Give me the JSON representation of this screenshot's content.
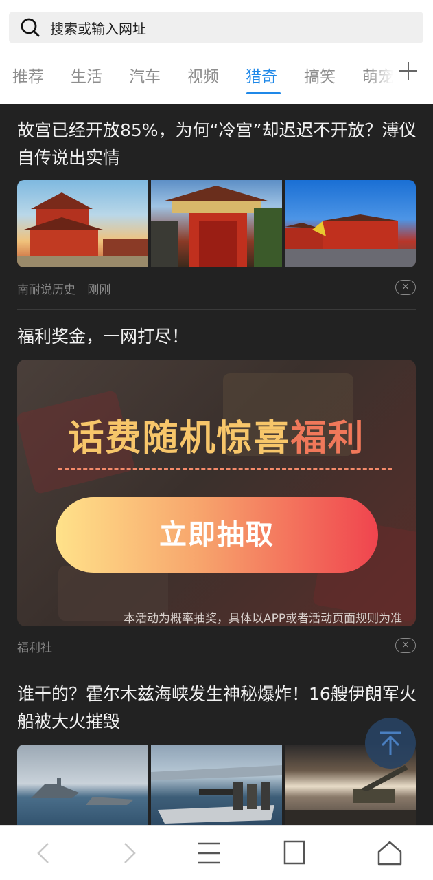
{
  "search": {
    "placeholder": "搜索或输入网址",
    "icon": "search-icon"
  },
  "tabs": [
    {
      "label": "推荐",
      "active": false
    },
    {
      "label": "生活",
      "active": false
    },
    {
      "label": "汽车",
      "active": false
    },
    {
      "label": "视频",
      "active": false
    },
    {
      "label": "猎奇",
      "active": true
    },
    {
      "label": "搞笑",
      "active": false
    },
    {
      "label": "萌宠",
      "active": false
    }
  ],
  "tabs_add_icon": "plus-icon",
  "feed": {
    "article1": {
      "title": "故宫已经开放85%，为何“冷宫”却迟迟不开放？溥仪自传说出实情",
      "source": "南耐说历史",
      "time": "刚刚",
      "dismiss": "×"
    },
    "ad": {
      "title": "福利奖金，一网打尽！",
      "headline_part1": "话费随机惊喜",
      "headline_part2": "福利",
      "button": "立即抽取",
      "note": "本活动为概率抽奖，具体以APP或者活动页面规则为准",
      "source": "福利社",
      "dismiss": "×"
    },
    "article2": {
      "title": "谁干的？霍尔木兹海峡发生神秘爆炸！16艘伊朗军火船被大火摧毁"
    }
  },
  "bottom_nav": {
    "tabs_count": "1",
    "icons": [
      "back-icon",
      "forward-icon",
      "menu-icon",
      "tabs-icon",
      "home-icon"
    ]
  },
  "colors": {
    "accent": "#1f88e8",
    "feed_bg": "#222222",
    "ad_button_start": "#ffe28a",
    "ad_button_end": "#f0444e"
  }
}
